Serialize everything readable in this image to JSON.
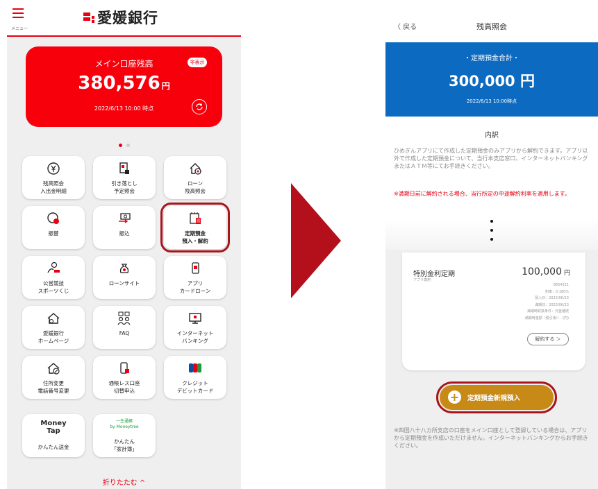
{
  "left": {
    "menu_label": "メニュー",
    "bank_name": "愛媛銀行",
    "balance_card": {
      "title": "メイン口座残高",
      "hide_label": "非表示",
      "amount": "380,576",
      "unit": "円",
      "timestamp": "2022/6/13 10:00 時点"
    },
    "tiles": [
      {
        "label": "残高照会\n入出金明細",
        "icon": "yen-circle-icon"
      },
      {
        "label": "引き落とし\n予定照会",
        "icon": "bill-icon"
      },
      {
        "label": "ローン\n残高照会",
        "icon": "house-yen-icon"
      },
      {
        "label": "振替",
        "icon": "transfer-icon"
      },
      {
        "label": "振込",
        "icon": "remittance-icon"
      },
      {
        "label": "定期預金\n預入・解約",
        "icon": "calendar-deposit-icon"
      },
      {
        "label": "公営競技\nスポーツくじ",
        "icon": "sports-icon"
      },
      {
        "label": "ローンサイト",
        "icon": "money-bag-icon"
      },
      {
        "label": "アプリ\nカードローン",
        "icon": "phone-card-icon"
      },
      {
        "label": "愛媛銀行\nホームページ",
        "icon": "home-icon"
      },
      {
        "label": "FAQ",
        "icon": "faq-people-icon"
      },
      {
        "label": "インターネット\nバンキング",
        "icon": "monitor-icon"
      },
      {
        "label": "住所変更\n電話番号変更",
        "icon": "house-edit-icon"
      },
      {
        "label": "通帳レス口座\n切替申込",
        "icon": "passbook-icon"
      },
      {
        "label": "クレジット\nデビットカード",
        "icon": "jcb-icon"
      },
      {
        "label": "かんたん送金",
        "icon": "money-tap-icon",
        "logo_text": "Money\nTap"
      },
      {
        "label": "かんたん\n「家計簿」",
        "icon": "kakeibo-icon",
        "logo_text": "一生通帳\nby Moneytree"
      }
    ],
    "collapse_label": "折りたたむ ^"
  },
  "right": {
    "back_label": "〈 戻る",
    "title": "残高照会",
    "banner": {
      "label": "・定期預金合計・",
      "amount": "300,000 円",
      "timestamp": "2022/6/13 10:00時点"
    },
    "breakdown_title": "内訳",
    "notice": "ひめぎんアプリにて作成した定期預金のみアプリから解約できます。アプリ以外で作成した定期預金について、当行本支店窓口、インターネットバンキングまたはＡＴＭ等にてお手続きください。",
    "warning": "※満期日前に解約される場合、当行所定の中途解約利率を適用します。",
    "deposit": {
      "name": "特別金利定期",
      "sub": "アプリ専用",
      "amount": "100,000",
      "unit": "円",
      "details": [
        "8654321",
        "利率：0.180%",
        "預入日：2022/06/13",
        "満期日：2023/06/13",
        "満期時取扱条件：元金継続",
        "満期時金額（税引後）：-(円)"
      ],
      "cancel_label": "解約する ＞"
    },
    "new_button_label": "定期預金新規預入",
    "footnote": "※四国八十八カ所支店の口座をメイン口座として登録している場合は、アプリから定期預金を作成いただけません。インターネットバンキングからお手続きください。"
  },
  "colors": {
    "brand_red": "#e60012",
    "banner_blue": "#0c6ac1",
    "gold": "#c78a16",
    "highlight": "#a8141c"
  }
}
